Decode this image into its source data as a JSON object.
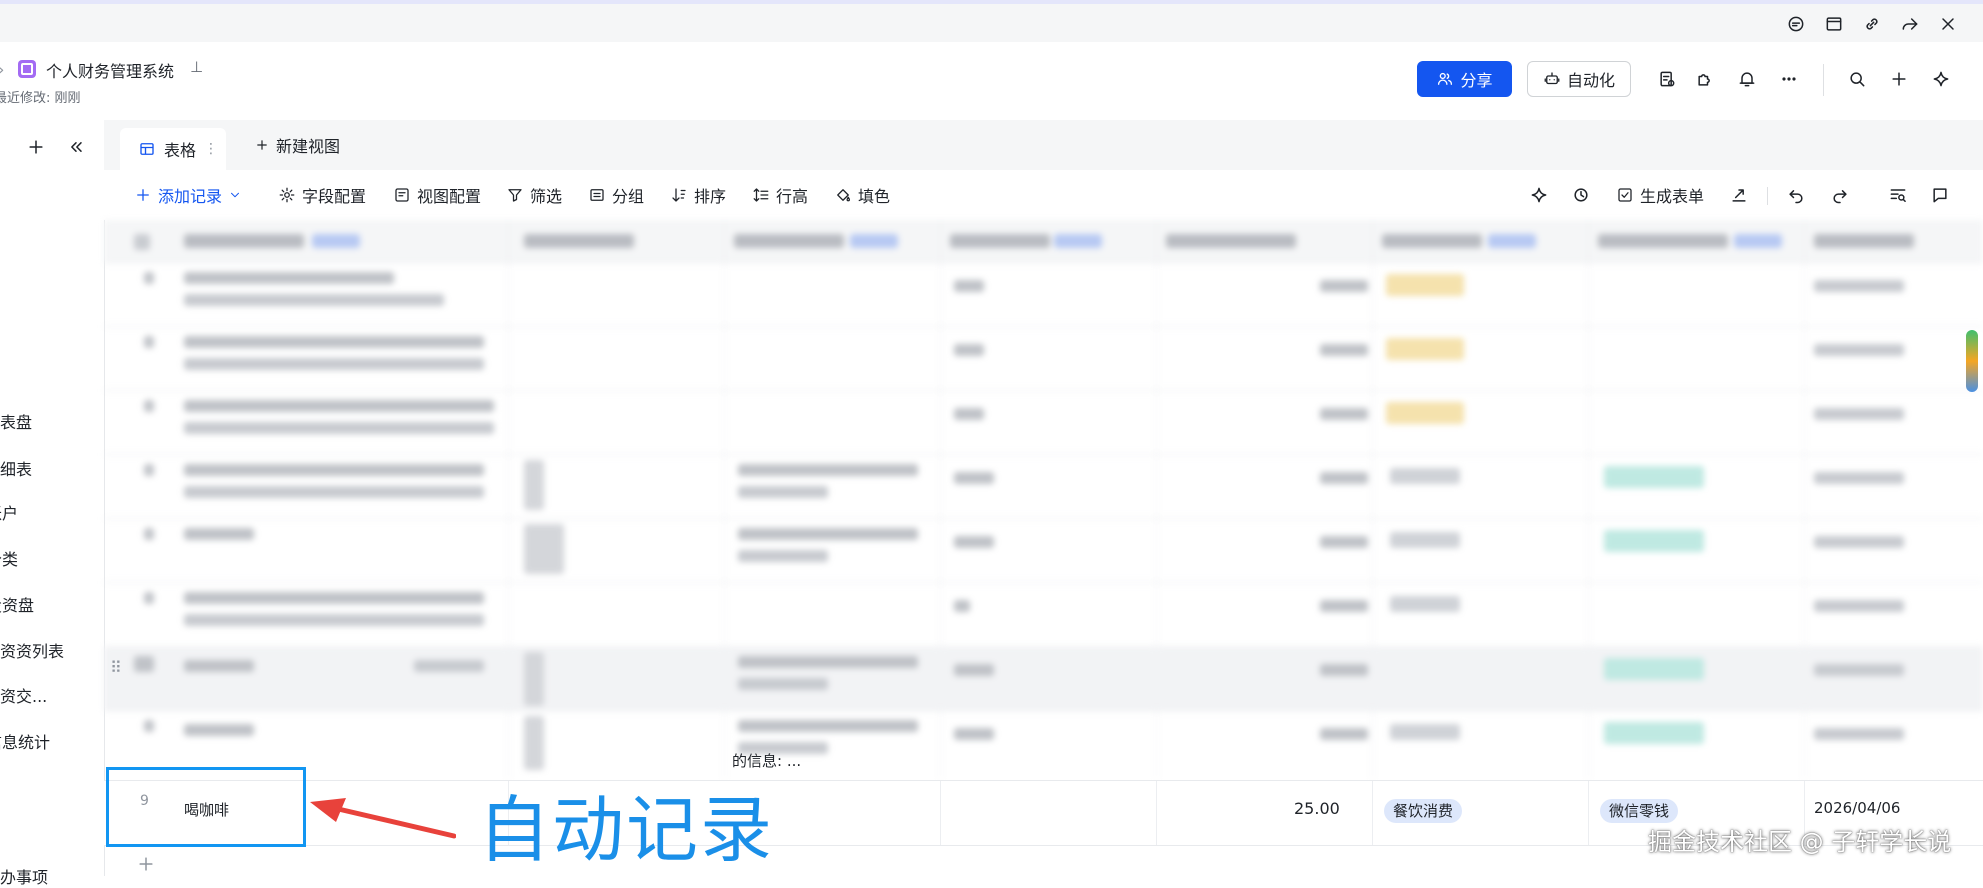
{
  "app": {
    "title": "个人财务管理系统",
    "subtitle": "最近修改: 刚刚",
    "share_label": "分享",
    "automation_label": "自动化"
  },
  "sidebar": {
    "items": [
      {
        "label": "仪表盘"
      },
      {
        "label": "明细表"
      },
      {
        "label": "账户"
      },
      {
        "label": "分类"
      },
      {
        "label": "投资盘"
      },
      {
        "label": "投资资列表"
      },
      {
        "label": "投资交..."
      },
      {
        "label": "信息统计"
      },
      {
        "label": "待办事项"
      }
    ]
  },
  "tabs": [
    {
      "label": "表格"
    },
    {
      "label": "新建视图"
    }
  ],
  "toolbar": {
    "add_record": "添加记录",
    "field_config": "字段配置",
    "view_config": "视图配置",
    "filter": "筛选",
    "group": "分组",
    "sort": "排序",
    "row_height": "行高",
    "fill_color": "填色",
    "generate_form": "生成表单"
  },
  "highlighted_record": {
    "index": "9",
    "name": "喝咖啡",
    "amount": "25.00",
    "category": "餐饮消费",
    "account": "微信零钱",
    "date": "2026/04/06"
  },
  "row8_partial_text": "的信息: ...",
  "annotation": {
    "label": "自动记录",
    "color": "#1a8fe8"
  },
  "watermark": "掘金技术社区 @ 子轩学长说",
  "colors": {
    "accent": "#1456f0",
    "category_tag_bg": "#dde7fb",
    "account_tag_bg": "#dde7fb"
  }
}
